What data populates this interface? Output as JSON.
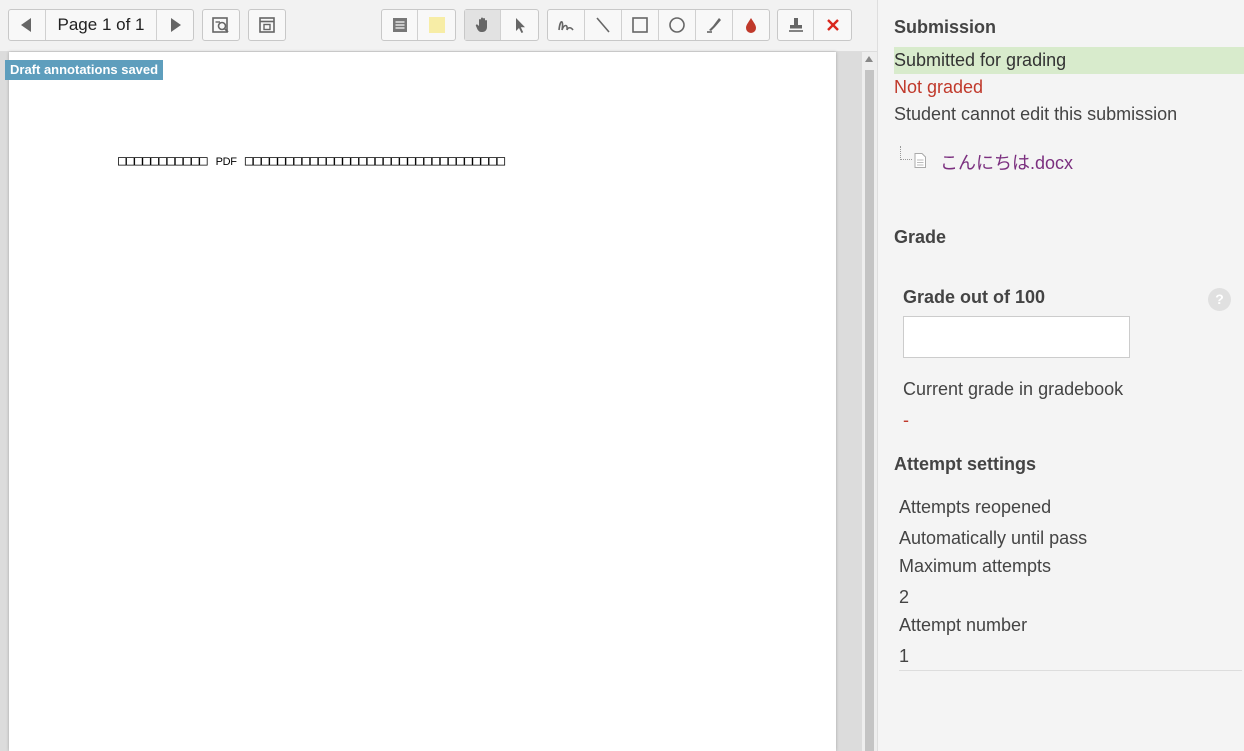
{
  "toolbar": {
    "page_label": "Page 1 of 1",
    "prev_icon": "triangle-left-icon",
    "next_icon": "triangle-right-icon"
  },
  "document": {
    "badge": "Draft annotations saved",
    "text_before": "□□□□□□□□□□□",
    "text_pdf": "PDF",
    "text_after": "□□□□□□□□□□□□□□□□□□□□□□□□□□□□□□□□"
  },
  "panel": {
    "submission_heading": "Submission",
    "status_submitted": "Submitted for grading",
    "status_graded": "Not graded",
    "status_edit": "Student cannot edit this submission",
    "file_name": "こんにちは.docx",
    "grade_heading": "Grade",
    "grade_out_of": "Grade out of 100",
    "grade_value": "",
    "help": "?",
    "current_grade_label": "Current grade in gradebook",
    "current_grade_value": "-",
    "attempt_heading": "Attempt settings",
    "attempts_reopened_label": "Attempts reopened",
    "attempts_reopened_value": "Automatically until pass",
    "max_attempts_label": "Maximum attempts",
    "max_attempts_value": "2",
    "attempt_number_label": "Attempt number",
    "attempt_number_value": "1"
  },
  "colors": {
    "badge": "#5e9ebd",
    "submitted_bg": "#d8ebcc",
    "not_graded": "#c0392b",
    "file_link": "#7b2f7f",
    "stamp_delete": "#d9261c",
    "colour_drop": "#c0392b",
    "highlight_swatch": "#f7eda6"
  }
}
